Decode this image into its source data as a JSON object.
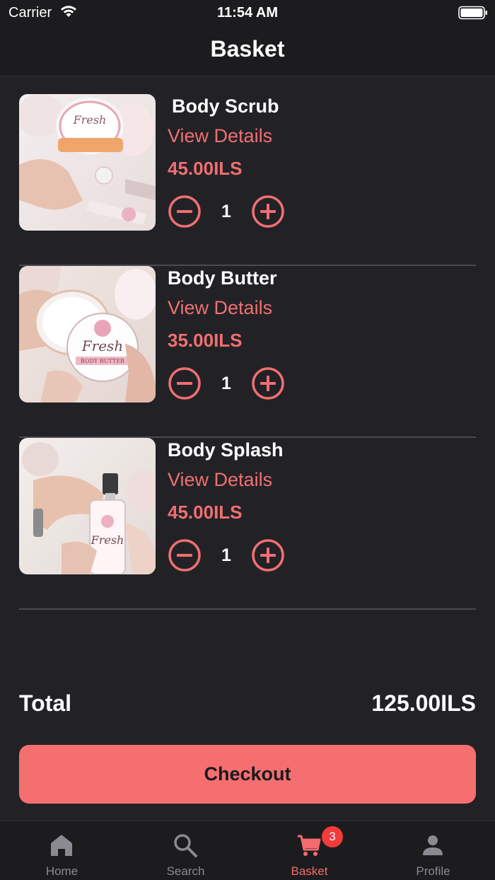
{
  "status_bar": {
    "carrier": "Carrier",
    "time": "11:54 AM",
    "wifi_icon": "wifi-icon",
    "battery_icon": "battery-icon"
  },
  "header": {
    "title": "Basket"
  },
  "items": [
    {
      "name": "Body Scrub",
      "view_details": "View Details",
      "price": "45.00ILS",
      "quantity": "1"
    },
    {
      "name": "Body Butter",
      "view_details": "View Details",
      "price": "35.00ILS",
      "quantity": "1"
    },
    {
      "name": "Body Splash",
      "view_details": "View Details",
      "price": "45.00ILS",
      "quantity": "1"
    }
  ],
  "total": {
    "label": "Total",
    "value": "125.00ILS"
  },
  "checkout": {
    "label": "Checkout"
  },
  "tab_bar": {
    "tabs": [
      {
        "label": "Home",
        "icon": "home-icon"
      },
      {
        "label": "Search",
        "icon": "search-icon"
      },
      {
        "label": "Basket",
        "icon": "cart-icon",
        "badge": "3"
      },
      {
        "label": "Profile",
        "icon": "person-icon"
      }
    ],
    "active": "Basket"
  },
  "colors": {
    "accent": "#f06f71",
    "checkout": "#f56f71",
    "background": "#222226",
    "badge": "#f23b3b"
  }
}
